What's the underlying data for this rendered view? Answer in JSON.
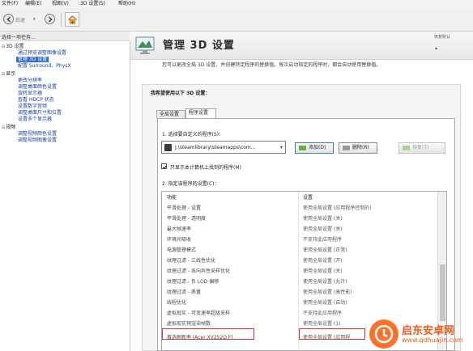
{
  "menu": {
    "items": [
      "文件(F)",
      "编辑(E)",
      "视图(V)",
      "3D 设置(S)",
      "帮助(H)"
    ]
  },
  "toolbar": {
    "back_label": "后退"
  },
  "tasks": {
    "header": "选择一项任务...",
    "tree": [
      {
        "label": "3D 设置",
        "type": "cat"
      },
      {
        "label": "通过预览调整图像设置",
        "type": "leaf"
      },
      {
        "label": "管理 3D 设置",
        "type": "selected"
      },
      {
        "label": "配置 Surround、PhysX",
        "type": "leaf"
      },
      {
        "label": "显示",
        "type": "cat"
      },
      {
        "label": "更改分辨率",
        "type": "leaf"
      },
      {
        "label": "调整桌面颜色设置",
        "type": "leaf"
      },
      {
        "label": "旋转显示器",
        "type": "leaf"
      },
      {
        "label": "查看 HDCP 状态",
        "type": "leaf"
      },
      {
        "label": "设置数字音频",
        "type": "leaf"
      },
      {
        "label": "调整桌面尺寸和位置",
        "type": "leaf"
      },
      {
        "label": "设置多个显示器",
        "type": "leaf"
      },
      {
        "label": "视频",
        "type": "cat"
      },
      {
        "label": "调整视频颜色设置",
        "type": "leaf"
      },
      {
        "label": "调整视频图像设置",
        "type": "leaf"
      }
    ]
  },
  "header": {
    "title": "管理 3D 设置",
    "restore": "恢复默认",
    "description": "您可以更改全局 3D 设置，并创建特定程序的替换值。每次启动指定的程序时，都会自动使用替换值。"
  },
  "panel": {
    "title": "我希望使用以下 3D 设置：",
    "tabs": [
      "全局设置",
      "程序设置"
    ],
    "step1": "1. 选择要自定义的程序(S)：",
    "program": "J:\\steamlibrary\\steamapps\\com...",
    "add_button": "添加(D)",
    "remove_button": "删除(R)",
    "restore_button": "恢复(T)",
    "checkbox_label": "只显示本计算机上找到的程序(M)",
    "step2": "2. 指定该程序的设置(C)："
  },
  "settings_table": {
    "columns": [
      "功能",
      "设置"
    ],
    "rows": [
      {
        "feature": "平滑处理 - 设置",
        "setting": "使用全局设置 (应用程序控制的)"
      },
      {
        "feature": "平滑处理 - 透明度",
        "setting": "使用全局设置 (关)"
      },
      {
        "feature": "最大帧速率",
        "setting": "使用全局设置 (关)"
      },
      {
        "feature": "环境光吸收",
        "setting": "不支持此应用程序"
      },
      {
        "feature": "电源管理模式",
        "setting": "使用全局设置 (正常)"
      },
      {
        "feature": "纹理过滤 - 三线性优化",
        "setting": "使用全局设置 (开)"
      },
      {
        "feature": "纹理过滤 - 各向异性采样优化",
        "setting": "使用全局设置 (关)"
      },
      {
        "feature": "纹理过滤 - 负 LOD 偏移",
        "setting": "使用全局设置 (允许)"
      },
      {
        "feature": "纹理过滤 - 质量",
        "setting": "使用全局设置 (高性能)"
      },
      {
        "feature": "线程优化",
        "setting": "使用全局设置 (自动)"
      },
      {
        "feature": "虚拟现实 - 可变速率超级采样",
        "setting": "不支持此应用程序"
      },
      {
        "feature": "虚拟现实预渲染帧数",
        "setting": "使用全局设置 (1)"
      },
      {
        "feature": "首选刷新率 (Acer XV252Q F)",
        "setting": "使用全局设置 (应用程"
      }
    ]
  },
  "watermark": {
    "text": "启东安卓网",
    "url": "www.qdhuajin.com"
  },
  "colors": {
    "selection": "#3169c6",
    "highlight": "#d6303a",
    "link": "#1a3f9a",
    "watermark": "#ef5a1a"
  }
}
